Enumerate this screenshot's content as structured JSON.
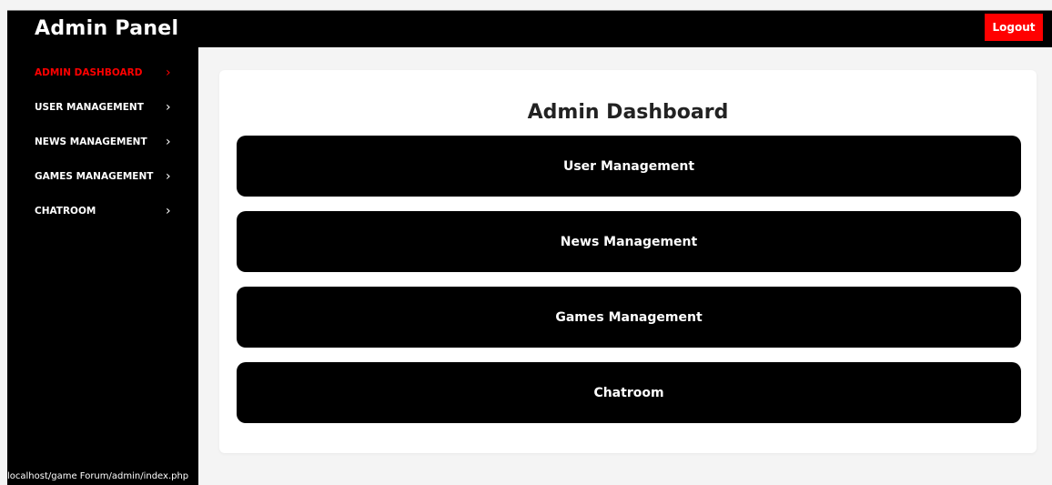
{
  "header": {
    "title": "Admin Panel",
    "logout_label": "Logout"
  },
  "sidebar": {
    "items": [
      {
        "label": "ADMIN DASHBOARD",
        "active": true
      },
      {
        "label": "USER MANAGEMENT",
        "active": false
      },
      {
        "label": "NEWS MANAGEMENT",
        "active": false
      },
      {
        "label": "GAMES MANAGEMENT",
        "active": false
      },
      {
        "label": "CHATROOM",
        "active": false
      }
    ],
    "chevron": "›"
  },
  "main": {
    "heading": "Admin Dashboard",
    "buttons": [
      {
        "label": "User Management"
      },
      {
        "label": "News Management"
      },
      {
        "label": "Games Management"
      },
      {
        "label": "Chatroom"
      }
    ]
  },
  "status_bar": {
    "url": "localhost/game Forum/admin/index.php"
  },
  "colors": {
    "accent": "#ff0000",
    "background": "#f4f4f4",
    "panel": "#000000"
  },
  "icons": {
    "chevron": "chevron-right-icon"
  }
}
